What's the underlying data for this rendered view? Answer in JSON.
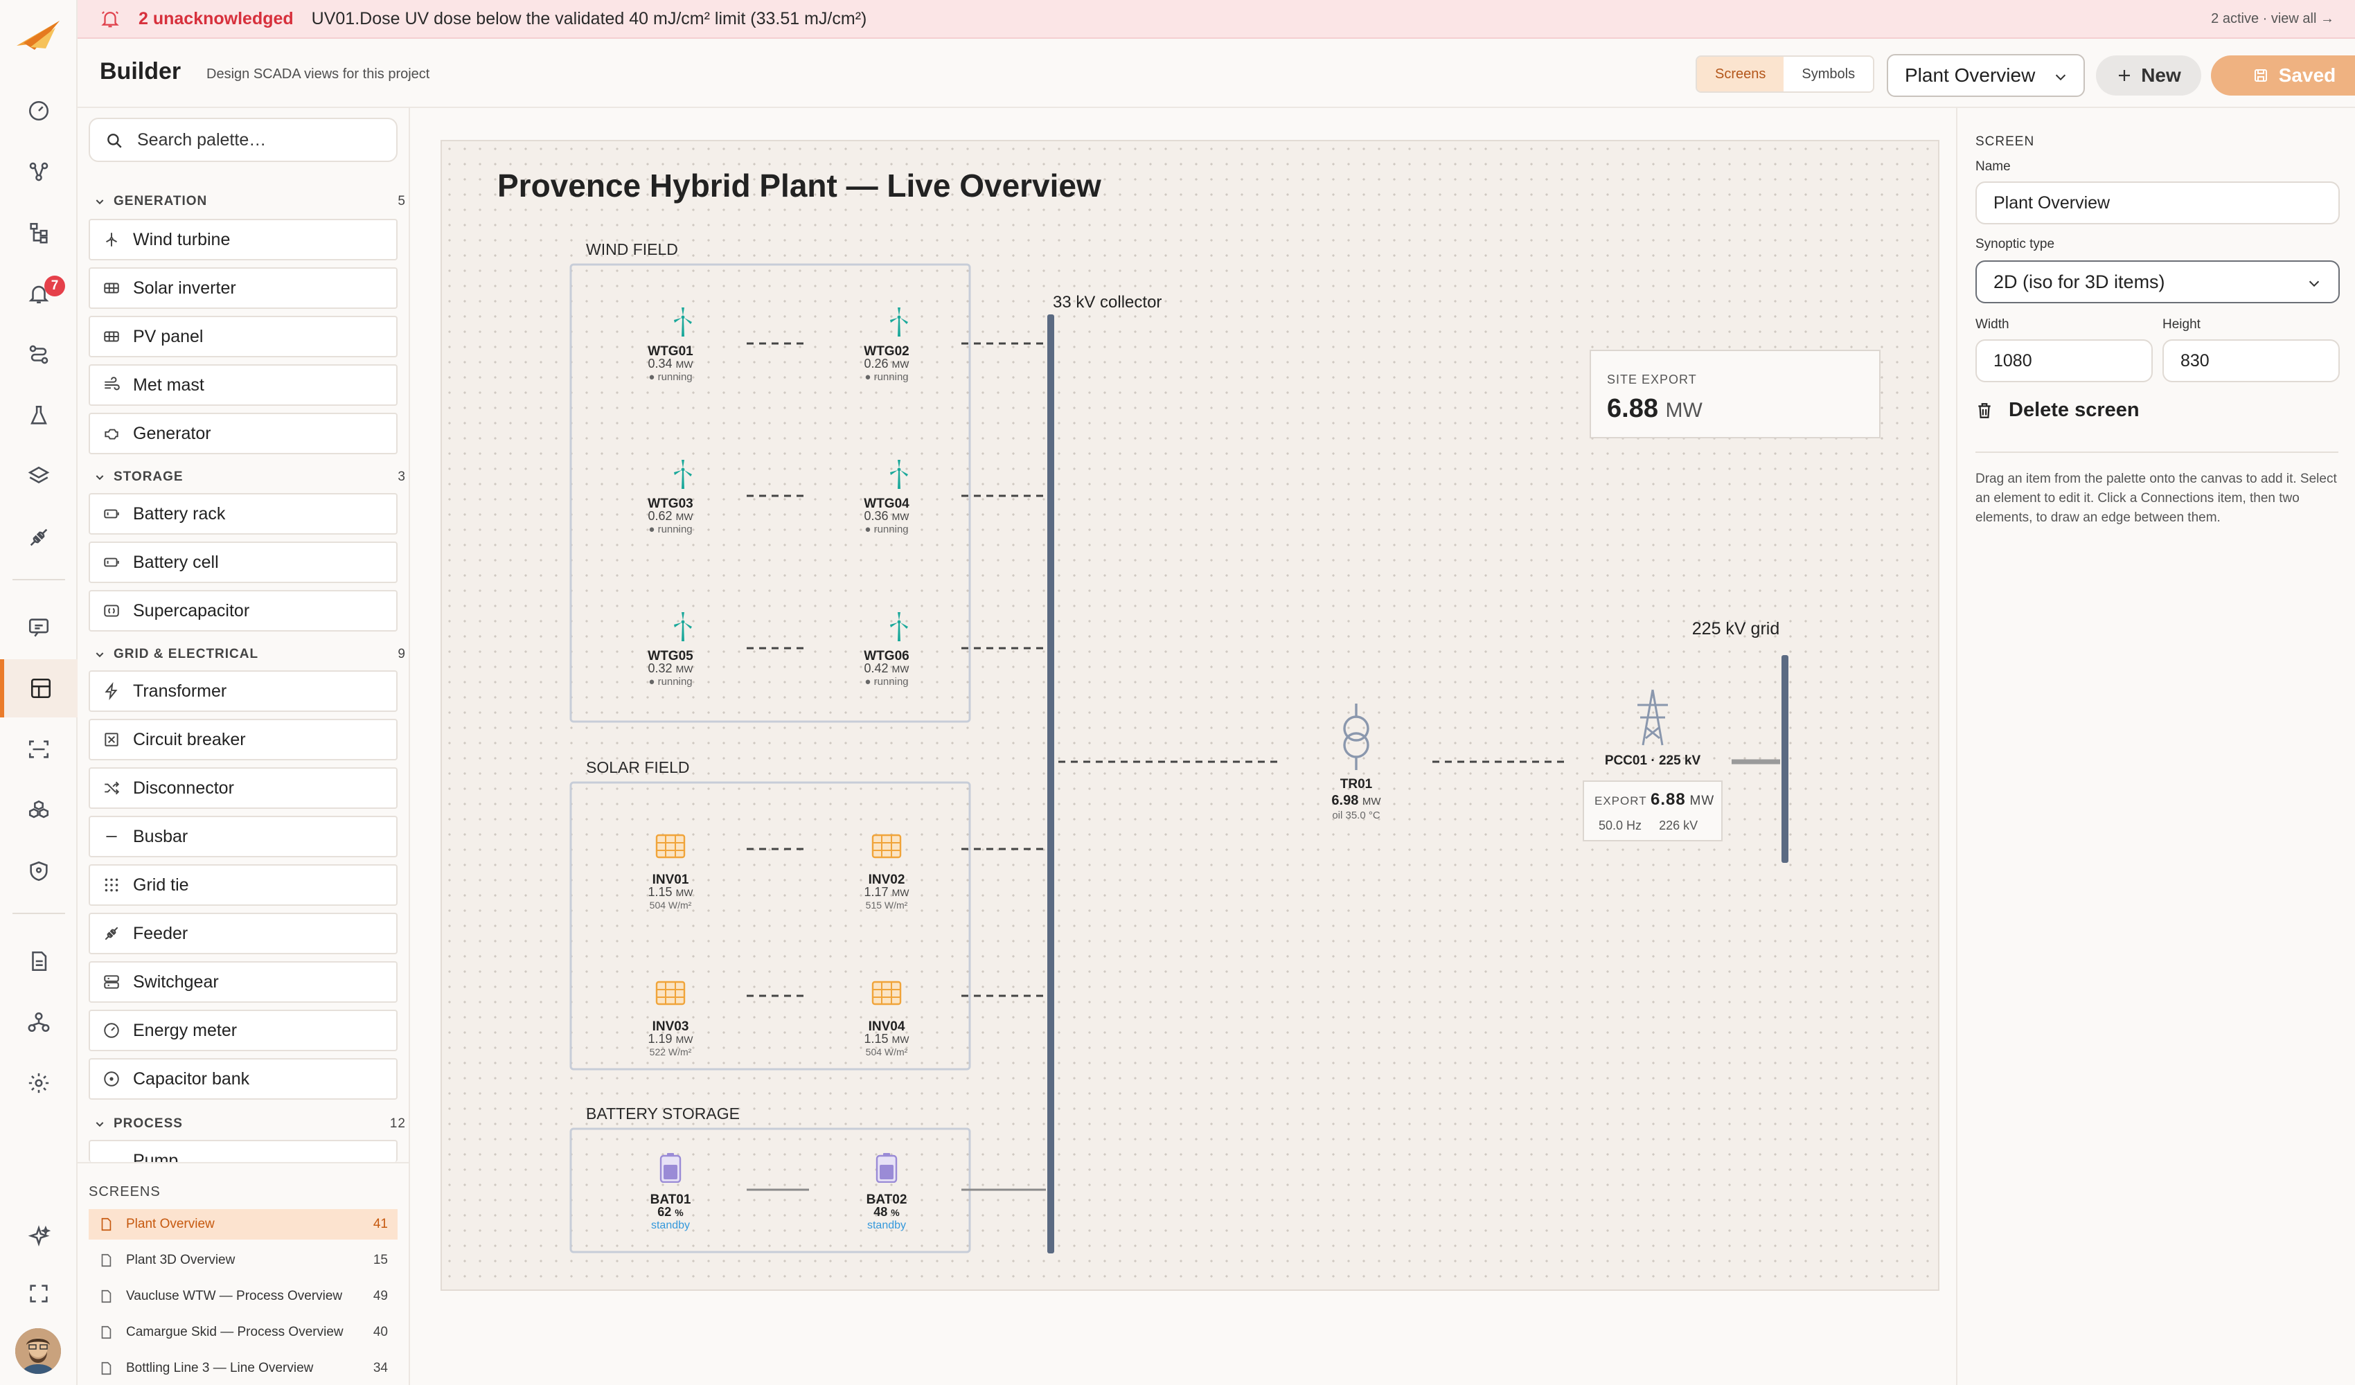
{
  "rail": {
    "alerts_badge": "7",
    "items": [
      {
        "name": "dashboard-icon"
      },
      {
        "name": "topology-icon"
      },
      {
        "name": "hierarchy-icon"
      },
      {
        "name": "alarms-icon"
      },
      {
        "name": "routes-icon"
      },
      {
        "name": "lab-icon"
      },
      {
        "name": "layers-icon"
      },
      {
        "name": "integrations-icon"
      },
      {
        "name": "chat-icon"
      },
      {
        "name": "builder-icon"
      },
      {
        "name": "scan-icon"
      },
      {
        "name": "assets-icon"
      },
      {
        "name": "security-icon"
      },
      {
        "name": "reports-icon"
      },
      {
        "name": "org-icon"
      },
      {
        "name": "settings-icon"
      },
      {
        "name": "ai-sparkle-icon"
      },
      {
        "name": "fullscreen-icon"
      }
    ]
  },
  "alarm": {
    "count": "2 unacknowledged",
    "message": "UV01.Dose UV dose below the validated 40 mJ/cm² limit (33.51 mJ/cm²)",
    "right": "2 active · view all →"
  },
  "header": {
    "title": "Builder",
    "subtitle": "Design SCADA views for this project",
    "tab_screens": "Screens",
    "tab_symbols": "Symbols",
    "screen_select": "Plant Overview",
    "new_label": "New",
    "saved_label": "Saved"
  },
  "palette": {
    "search_placeholder": "Search palette…",
    "categories": [
      {
        "label": "GENERATION",
        "count": "5",
        "items": [
          "Wind turbine",
          "Solar inverter",
          "PV panel",
          "Met mast",
          "Generator"
        ]
      },
      {
        "label": "STORAGE",
        "count": "3",
        "items": [
          "Battery rack",
          "Battery cell",
          "Supercapacitor"
        ]
      },
      {
        "label": "GRID & ELECTRICAL",
        "count": "9",
        "items": [
          "Transformer",
          "Circuit breaker",
          "Disconnector",
          "Busbar",
          "Grid tie",
          "Feeder",
          "Switchgear",
          "Energy meter",
          "Capacitor bank"
        ]
      },
      {
        "label": "PROCESS",
        "count": "12",
        "items": [
          "Pump"
        ]
      }
    ]
  },
  "screens": {
    "label": "SCREENS",
    "items": [
      {
        "name": "Plant Overview",
        "count": "41"
      },
      {
        "name": "Plant 3D Overview",
        "count": "15"
      },
      {
        "name": "Vaucluse WTW — Process Overview",
        "count": "49"
      },
      {
        "name": "Camargue Skid — Process Overview",
        "count": "40"
      },
      {
        "name": "Bottling Line 3 — Line Overview",
        "count": "34"
      }
    ]
  },
  "synoptic": {
    "title": "Provence Hybrid Plant — Live Overview",
    "wind_label": "WIND FIELD",
    "solar_label": "SOLAR FIELD",
    "battery_label": "BATTERY STORAGE",
    "collector_label": "33 kV collector",
    "grid_label": "225 kV grid",
    "site_export_label": "SITE EXPORT",
    "site_export_value": "6.88",
    "site_export_unit": "MW",
    "turbines": [
      {
        "id": "WTG01",
        "mw": "0.34",
        "state": "● running"
      },
      {
        "id": "WTG02",
        "mw": "0.26",
        "state": "● running"
      },
      {
        "id": "WTG03",
        "mw": "0.62",
        "state": "● running"
      },
      {
        "id": "WTG04",
        "mw": "0.36",
        "state": "● running"
      },
      {
        "id": "WTG05",
        "mw": "0.32",
        "state": "● running"
      },
      {
        "id": "WTG06",
        "mw": "0.42",
        "state": "● running"
      }
    ],
    "inverters": [
      {
        "id": "INV01",
        "mw": "1.15",
        "irr": "504 W/m²"
      },
      {
        "id": "INV02",
        "mw": "1.17",
        "irr": "515 W/m²"
      },
      {
        "id": "INV03",
        "mw": "1.19",
        "irr": "522 W/m²"
      },
      {
        "id": "INV04",
        "mw": "1.15",
        "irr": "504 W/m²"
      }
    ],
    "batteries": [
      {
        "id": "BAT01",
        "soc": "62",
        "state": "standby"
      },
      {
        "id": "BAT02",
        "soc": "48",
        "state": "standby"
      }
    ],
    "unit_mw": "MW",
    "unit_pct": "%",
    "transformer": {
      "id": "TR01",
      "mw": "6.98",
      "oil": "oil 35.0 °C"
    },
    "pcc": {
      "id": "PCC01 · 225 kV",
      "export_label": "EXPORT",
      "export_value": "6.88",
      "hz": "50.0 Hz",
      "kv": "226 kV"
    }
  },
  "inspector": {
    "section": "SCREEN",
    "name_label": "Name",
    "name_value": "Plant Overview",
    "type_label": "Synoptic type",
    "type_value": "2D (iso for 3D items)",
    "width_label": "Width",
    "width_value": "1080",
    "height_label": "Height",
    "height_value": "830",
    "delete_label": "Delete screen",
    "hint": "Drag an item from the palette onto the canvas to add it. Select an element to edit it. Click a Connections item, then two elements, to draw an edge between them."
  },
  "colors": {
    "accent": "#ea7b2a",
    "turbine": "#1aa89a",
    "solar": "#f0a43a",
    "battery": "#9a8bd6",
    "bus": "#5b6a82",
    "alarm_bg": "#fbe5e6"
  }
}
